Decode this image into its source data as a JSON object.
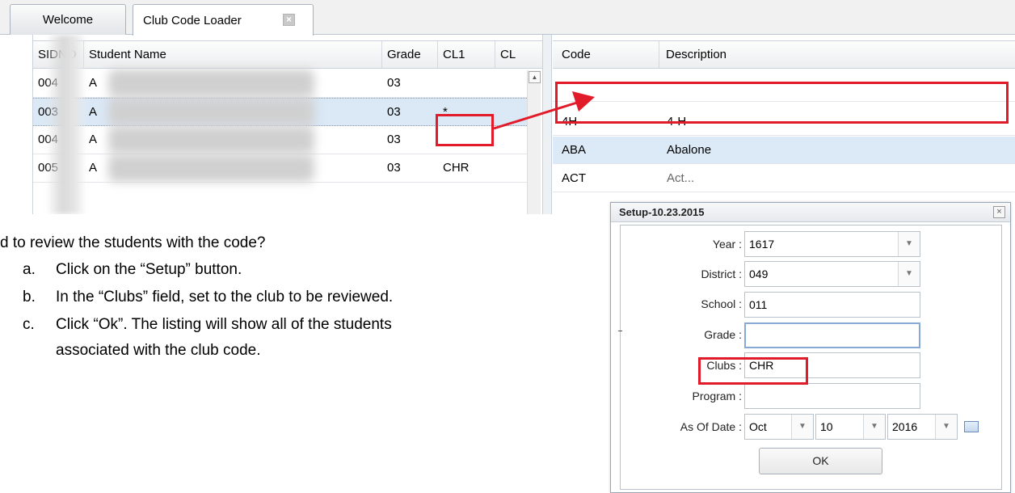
{
  "tabs": {
    "welcome": "Welcome",
    "club_loader": "Club Code Loader",
    "close_glyph": "×"
  },
  "left_grid": {
    "columns": [
      "SIDNO",
      "Student Name",
      "Grade",
      "CL1",
      "CL"
    ],
    "rows": [
      {
        "sidno": "004",
        "name": "A",
        "grade": "03",
        "cl1": ""
      },
      {
        "sidno": "003",
        "name": "A",
        "grade": "03",
        "cl1": "*"
      },
      {
        "sidno": "004",
        "name": "A",
        "grade": "03",
        "cl1": ""
      },
      {
        "sidno": "005",
        "name": "A",
        "grade": "03",
        "cl1": "CHR"
      }
    ]
  },
  "right_grid": {
    "columns": [
      "Code",
      "Description"
    ],
    "rows": [
      {
        "code": "",
        "desc": ""
      },
      {
        "code": "4H",
        "desc": "4-H"
      },
      {
        "code": "ABA",
        "desc": "Abalone"
      },
      {
        "code": "ACT",
        "desc": "Act..."
      }
    ]
  },
  "instructions": {
    "question": "d to review the students with the code?",
    "steps": [
      {
        "letter": "a.",
        "text": "Click on the “Setup” button."
      },
      {
        "letter": "b.",
        "text": "In the “Clubs” field, set to the club to be reviewed."
      },
      {
        "letter": "c.",
        "text": "Click “Ok”.  The listing will show all of the students"
      },
      {
        "letter": "",
        "text": "associated with the club code."
      }
    ]
  },
  "setup_dialog": {
    "title": "Setup-10.23.2015",
    "close_glyph": "×",
    "fields": {
      "year": {
        "label": "Year :",
        "value": "1617"
      },
      "district": {
        "label": "District :",
        "value": "049"
      },
      "school": {
        "label": "School :",
        "value": "011"
      },
      "grade": {
        "label": "Grade :",
        "value": ""
      },
      "clubs": {
        "label": "Clubs :",
        "value": "CHR"
      },
      "program": {
        "label": "Program :",
        "value": ""
      },
      "as_of_date": {
        "label": "As Of Date :",
        "month": "Oct",
        "day": "10",
        "year": "2016"
      }
    },
    "ok_label": "OK"
  },
  "colors": {
    "annotation_red": "#e21b2b",
    "selection_blue": "#dbe8f6"
  }
}
